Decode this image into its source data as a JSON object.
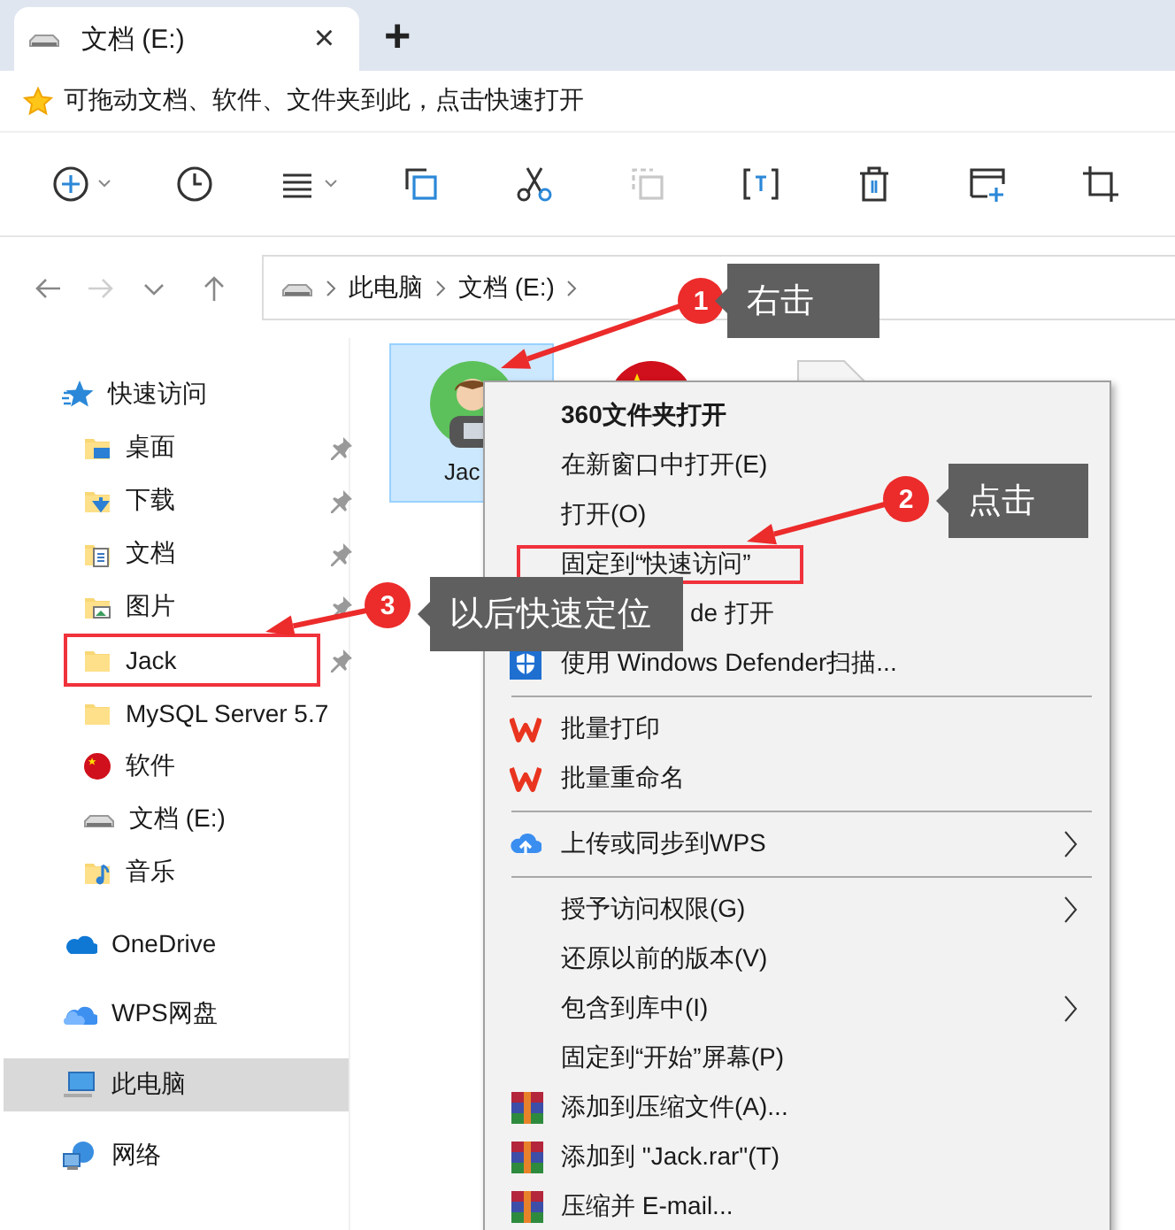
{
  "tabs": [
    {
      "title": "文档 (E:)",
      "selected": true
    }
  ],
  "close_glyph": "×",
  "new_tab_glyph": "+",
  "favorites_bar": {
    "text": "可拖动文档、软件、文件夹到此，点击快速打开"
  },
  "toolbar": {
    "buttons": [
      {
        "kind": "new",
        "dropdown": true,
        "disabled": false
      },
      {
        "kind": "recent",
        "dropdown": false,
        "disabled": false
      },
      {
        "kind": "view",
        "dropdown": true,
        "disabled": false
      },
      {
        "kind": "copy",
        "dropdown": false,
        "disabled": false
      },
      {
        "kind": "cut",
        "dropdown": false,
        "disabled": false
      },
      {
        "kind": "paste",
        "dropdown": false,
        "disabled": true
      },
      {
        "kind": "rename",
        "dropdown": false,
        "disabled": false
      },
      {
        "kind": "delete",
        "dropdown": false,
        "disabled": false
      },
      {
        "kind": "newfolder",
        "dropdown": false,
        "disabled": false
      },
      {
        "kind": "crop",
        "dropdown": false,
        "disabled": false
      }
    ]
  },
  "navigation": {
    "buttons": [
      {
        "kind": "back",
        "disabled": false
      },
      {
        "kind": "forward",
        "disabled": true
      },
      {
        "kind": "recent",
        "disabled": false
      },
      {
        "kind": "up",
        "disabled": false
      }
    ],
    "address": [
      "此电脑",
      "文档 (E:)"
    ]
  },
  "sidebar": {
    "items": [
      {
        "label": "快速访问",
        "kind": "quick",
        "selected": false,
        "children": [
          {
            "label": "桌面",
            "kind": "desktop",
            "pinned": true,
            "highlighted": false,
            "selected": false
          },
          {
            "label": "下载",
            "kind": "download",
            "pinned": true,
            "highlighted": false,
            "selected": false
          },
          {
            "label": "文档",
            "kind": "documents",
            "pinned": true,
            "highlighted": false,
            "selected": false
          },
          {
            "label": "图片",
            "kind": "pictures",
            "pinned": true,
            "highlighted": false,
            "selected": false
          },
          {
            "label": "Jack",
            "kind": "folder",
            "pinned": true,
            "highlighted": true,
            "selected": false
          },
          {
            "label": "MySQL Server 5.7",
            "kind": "folder",
            "pinned": false,
            "highlighted": false,
            "selected": false
          },
          {
            "label": "软件",
            "kind": "flag",
            "pinned": false,
            "highlighted": false,
            "selected": false
          },
          {
            "label": "文档 (E:)",
            "kind": "drive",
            "pinned": false,
            "highlighted": false,
            "selected": false
          },
          {
            "label": "音乐",
            "kind": "music",
            "pinned": false,
            "highlighted": false,
            "selected": false
          }
        ]
      },
      {
        "label": "OneDrive",
        "kind": "onedrive",
        "selected": false
      },
      {
        "label": "WPS网盘",
        "kind": "wpscloud",
        "selected": false
      },
      {
        "label": "此电脑",
        "kind": "pc",
        "selected": true
      },
      {
        "label": "网络",
        "kind": "network",
        "selected": false
      }
    ]
  },
  "content": {
    "items": [
      {
        "kind": "avatar",
        "label": "Jac",
        "selected": true
      },
      {
        "kind": "flag",
        "selected": false
      },
      {
        "kind": "document",
        "selected": false
      }
    ]
  },
  "context_menu": {
    "entries": [
      {
        "kind": "text",
        "label": "360文件夹打开",
        "bold": true,
        "submenu": false,
        "highlighted": false
      },
      {
        "kind": "text",
        "label": "在新窗口中打开(E)",
        "bold": false,
        "submenu": false,
        "highlighted": false
      },
      {
        "kind": "text",
        "label": "打开(O)",
        "bold": false,
        "submenu": false,
        "highlighted": false
      },
      {
        "kind": "text",
        "label": "固定到“快速访问”",
        "bold": false,
        "submenu": false,
        "highlighted": true
      },
      {
        "kind": "covered",
        "label": "de 打开",
        "bold": false,
        "submenu": false,
        "highlighted": false
      },
      {
        "kind": "defender",
        "label": "使用 Windows Defender扫描...",
        "bold": false,
        "submenu": false,
        "highlighted": false
      },
      {
        "kind": "separator"
      },
      {
        "kind": "wps",
        "label": "批量打印",
        "bold": false,
        "submenu": false,
        "highlighted": false
      },
      {
        "kind": "wps",
        "label": "批量重命名",
        "bold": false,
        "submenu": false,
        "highlighted": false
      },
      {
        "kind": "separator"
      },
      {
        "kind": "upload",
        "label": "上传或同步到WPS",
        "bold": false,
        "submenu": true,
        "highlighted": false
      },
      {
        "kind": "separator"
      },
      {
        "kind": "text",
        "label": "授予访问权限(G)",
        "bold": false,
        "submenu": true,
        "highlighted": false
      },
      {
        "kind": "text",
        "label": "还原以前的版本(V)",
        "bold": false,
        "submenu": false,
        "highlighted": false
      },
      {
        "kind": "text",
        "label": "包含到库中(I)",
        "bold": false,
        "submenu": true,
        "highlighted": false
      },
      {
        "kind": "text",
        "label": "固定到“开始”屏幕(P)",
        "bold": false,
        "submenu": false,
        "highlighted": false
      },
      {
        "kind": "archive",
        "label": "添加到压缩文件(A)...",
        "bold": false,
        "submenu": false,
        "highlighted": false
      },
      {
        "kind": "archive",
        "label": "添加到 \"Jack.rar\"(T)",
        "bold": false,
        "submenu": false,
        "highlighted": false
      },
      {
        "kind": "archive",
        "label": "压缩并 E-mail...",
        "bold": false,
        "submenu": false,
        "highlighted": false
      }
    ]
  },
  "annotations": [
    {
      "number": "1",
      "text": "右击"
    },
    {
      "number": "2",
      "text": "点击"
    },
    {
      "number": "3",
      "text": "以后快速定位"
    }
  ]
}
